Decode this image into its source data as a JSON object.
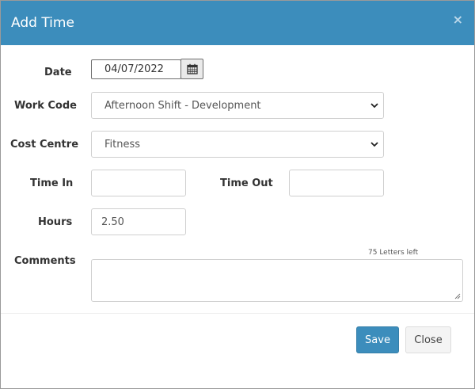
{
  "dialog": {
    "title": "Add Time",
    "close_glyph": "×",
    "header_color": "#3c8dbc"
  },
  "form": {
    "date": {
      "label": "Date",
      "value": "04/07/2022",
      "button_icon": "calendar-icon"
    },
    "work_code": {
      "label": "Work Code",
      "selected": "Afternoon Shift - Development"
    },
    "cost_centre": {
      "label": "Cost Centre",
      "selected": "Fitness"
    },
    "time_in": {
      "label": "Time In",
      "value": ""
    },
    "time_out": {
      "label": "Time Out",
      "value": ""
    },
    "hours": {
      "label": "Hours",
      "value": "2.50"
    },
    "comments": {
      "label": "Comments",
      "value": "",
      "counter": "75 Letters left"
    }
  },
  "footer": {
    "save_label": "Save",
    "close_label": "Close",
    "save_color": "#3c8dbc"
  }
}
